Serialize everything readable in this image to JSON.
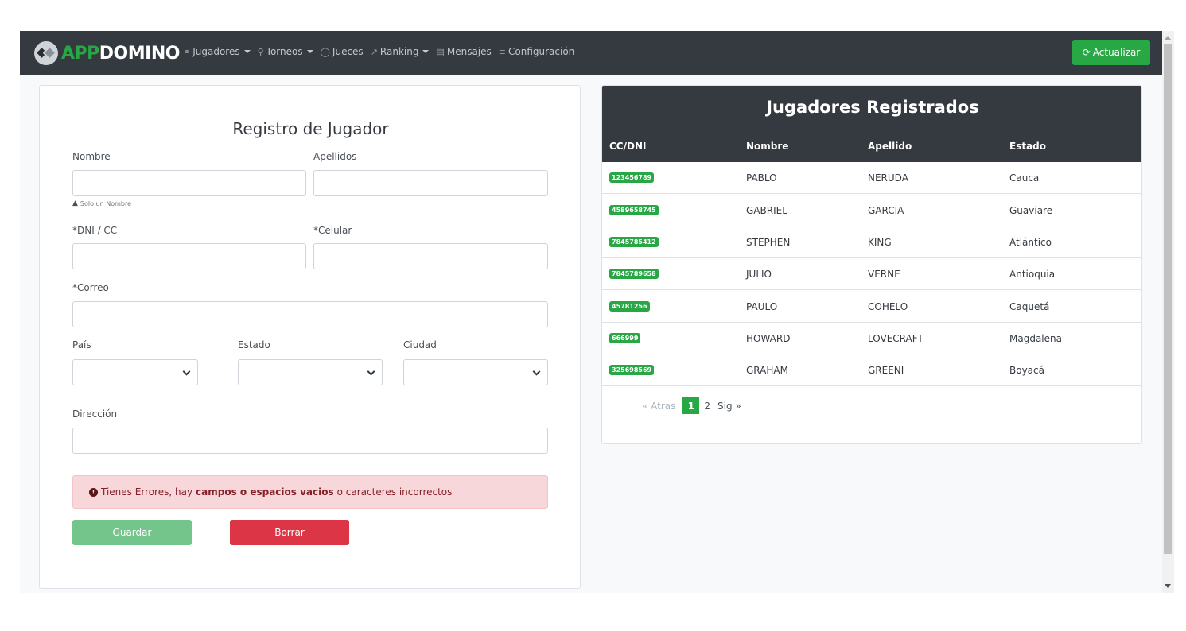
{
  "navbar": {
    "brand_app": "APP",
    "brand_domino": "DOMINO",
    "items": [
      {
        "label": "Jugadores",
        "icon": "users-icon",
        "dropdown": true
      },
      {
        "label": "Torneos",
        "icon": "trophy-icon",
        "dropdown": true
      },
      {
        "label": "Jueces",
        "icon": "shield-icon",
        "dropdown": false
      },
      {
        "label": "Ranking",
        "icon": "chart-line-icon",
        "dropdown": true
      },
      {
        "label": "Mensajes",
        "icon": "message-icon",
        "dropdown": false
      },
      {
        "label": "Configuración",
        "icon": "settings-icon",
        "dropdown": false
      }
    ],
    "refresh_label": "Actualizar"
  },
  "form": {
    "title": "Registro de Jugador",
    "nombre_label": "Nombre",
    "apellidos_label": "Apellidos",
    "nombre_hint": "Solo un Nombre",
    "dni_label": "*DNI / CC",
    "celular_label": "*Celular",
    "correo_label": "*Correo",
    "pais_label": "País",
    "estado_label": "Estado",
    "ciudad_label": "Ciudad",
    "direccion_label": "Dirección",
    "alert_prefix": "Tienes Errores, hay",
    "alert_bold": "campos o espacios vacios",
    "alert_suffix": "o caracteres incorrectos",
    "save_label": "Guardar",
    "clear_label": "Borrar"
  },
  "table": {
    "title": "Jugadores Registrados",
    "columns": [
      "CC/DNI",
      "Nombre",
      "Apellido",
      "Estado"
    ],
    "rows": [
      {
        "id": "123456789",
        "nombre": "PABLO",
        "apellido": "NERUDA",
        "estado": "Cauca"
      },
      {
        "id": "4589658745",
        "nombre": "GABRIEL",
        "apellido": "GARCIA",
        "estado": "Guaviare"
      },
      {
        "id": "7845785412",
        "nombre": "STEPHEN",
        "apellido": "KING",
        "estado": "Atlántico"
      },
      {
        "id": "7845789658",
        "nombre": "JULIO",
        "apellido": "VERNE",
        "estado": "Antioquia"
      },
      {
        "id": "45781256",
        "nombre": "PAULO",
        "apellido": "COHELO",
        "estado": "Caquetá"
      },
      {
        "id": "666999",
        "nombre": "HOWARD",
        "apellido": "LOVECRAFT",
        "estado": "Magdalena"
      },
      {
        "id": "325698569",
        "nombre": "GRAHAM",
        "apellido": "GREENI",
        "estado": "Boyacá"
      }
    ]
  },
  "pagination": {
    "prev_label": "« Atras",
    "pages": [
      "1",
      "2"
    ],
    "current": "1",
    "next_label": "Sig »"
  }
}
